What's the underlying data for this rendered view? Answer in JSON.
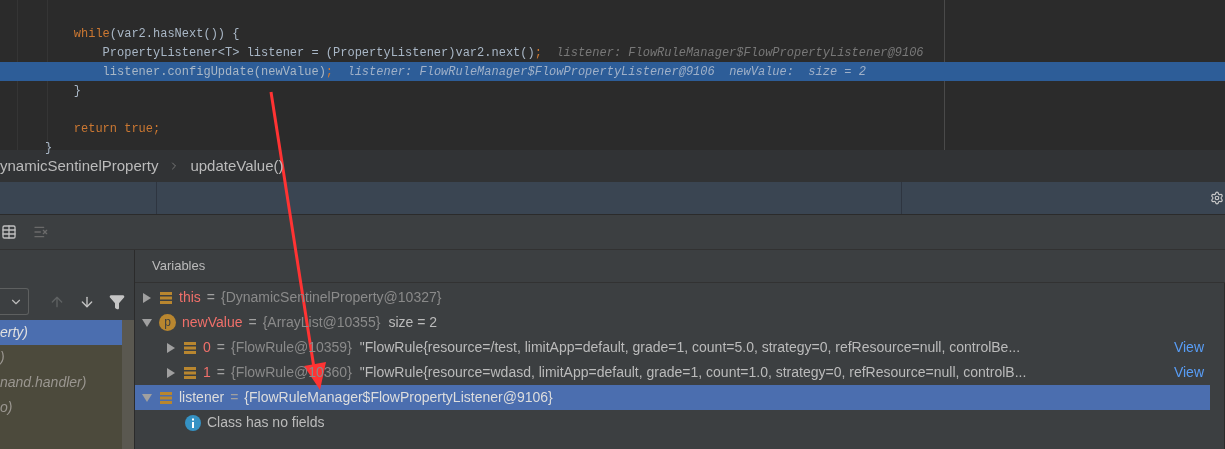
{
  "editor": {
    "lines": [
      {
        "kind": "code",
        "highlighted": false,
        "segments": [
          {
            "kind": "keyword",
            "text": "    while"
          },
          {
            "kind": "plain",
            "text": "(var2.hasNext()) {"
          }
        ]
      },
      {
        "kind": "code",
        "highlighted": false,
        "segments": [
          {
            "kind": "plain",
            "text": "        PropertyListener<T> listener = (PropertyListener)var2.next()"
          },
          {
            "kind": "keyword",
            "text": ";"
          },
          {
            "kind": "hint",
            "text": "  listener: FlowRuleManager$FlowPropertyListener@9106"
          }
        ]
      },
      {
        "kind": "code",
        "highlighted": true,
        "segments": [
          {
            "kind": "plain",
            "text": "        listener.configUpdate(newValue)"
          },
          {
            "kind": "keyword",
            "text": ";"
          },
          {
            "kind": "hint",
            "text": "  listener: FlowRuleManager$FlowPropertyListener@9106  newValue:  size = 2"
          }
        ]
      },
      {
        "kind": "code",
        "highlighted": false,
        "segments": [
          {
            "kind": "plain",
            "text": "    }"
          }
        ]
      },
      {
        "kind": "blank"
      },
      {
        "kind": "code",
        "highlighted": false,
        "segments": [
          {
            "kind": "keyword",
            "text": "    return true;"
          }
        ]
      },
      {
        "kind": "code",
        "highlighted": false,
        "segments": [
          {
            "kind": "plain",
            "text": "}"
          }
        ]
      }
    ]
  },
  "breadcrumb": [
    "ynamicSentinelProperty",
    "updateValue()"
  ],
  "frames": [
    {
      "text": "erty)",
      "selected": true
    },
    {
      "text": ")",
      "selected": false
    },
    {
      "text": "nand.handler)",
      "selected": false
    },
    {
      "text": "o)",
      "selected": false
    }
  ],
  "variables": {
    "title": "Variables",
    "items": [
      {
        "kind": "field",
        "name": "this",
        "op": "=",
        "value": "{DynamicSentinelProperty@10327}",
        "expanded": false,
        "selected": false
      },
      {
        "kind": "param",
        "badge": "p",
        "name": "newValue",
        "op": "=",
        "value": "{ArrayList@10355}",
        "extra": "size = 2",
        "expanded": true,
        "selected": false,
        "children": [
          {
            "kind": "field",
            "name": "0",
            "op": "=",
            "value": "{FlowRule@10359}",
            "extra": "\"FlowRule{resource=/test, limitApp=default, grade=1, count=5.0, strategy=0, refResource=null, controlBe...",
            "link": "View",
            "expanded": false,
            "selected": false
          },
          {
            "kind": "field",
            "name": "1",
            "op": "=",
            "value": "{FlowRule@10360}",
            "extra": "\"FlowRule{resource=wdasd, limitApp=default, grade=1, count=1.0, strategy=0, refResource=null, controlB...",
            "link": "View",
            "expanded": false,
            "selected": false
          }
        ]
      },
      {
        "kind": "field",
        "name": "listener",
        "op": "=",
        "value": "{FlowRuleManager$FlowPropertyListener@9106}",
        "expanded": true,
        "selected": true,
        "children": [
          {
            "kind": "info",
            "text": "Class has no fields"
          }
        ]
      }
    ]
  }
}
